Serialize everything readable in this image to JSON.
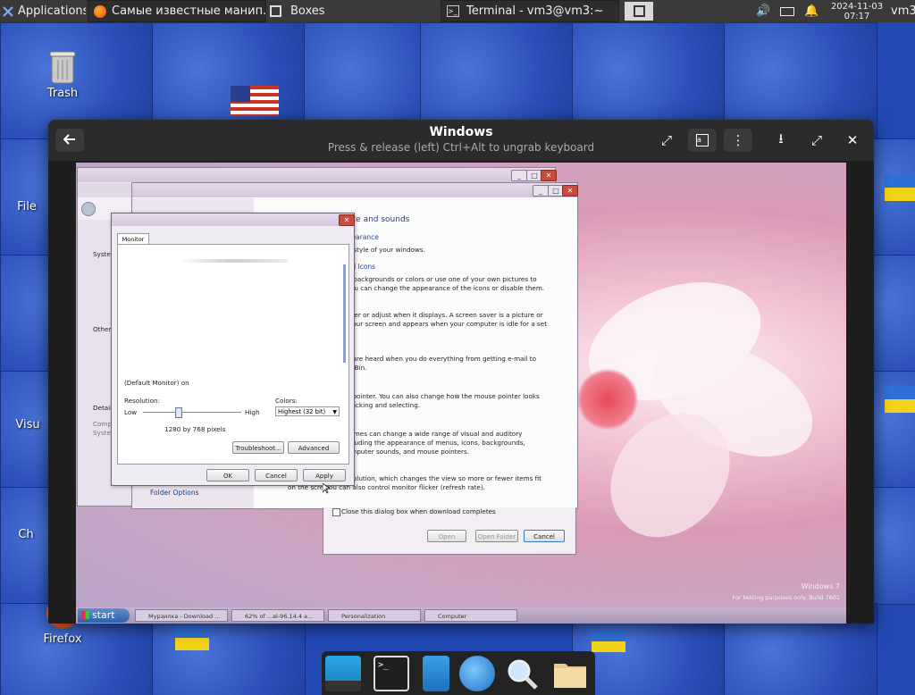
{
  "topbar": {
    "applications_label": "Applications",
    "tasks": [
      {
        "label": "Самые известные манип...",
        "icon": "firefox-icon"
      },
      {
        "label": "Boxes",
        "icon": "boxes-icon"
      },
      {
        "label": "Terminal - vm3@vm3:~",
        "icon": "terminal-icon"
      }
    ],
    "date": "2024-11-03",
    "time": "07:17",
    "user": "vm3"
  },
  "desktop_icons": [
    {
      "label": "Trash"
    },
    {
      "label": "File"
    },
    {
      "label": "Visu"
    },
    {
      "label": "Ch"
    },
    {
      "label": "Firefox"
    }
  ],
  "boxes_window": {
    "title": "Windows",
    "subtitle": "Press & release (left) Ctrl+Alt to ungrab keyboard"
  },
  "guest": {
    "monitor_dialog": {
      "tab": "Monitor",
      "default_monitor": "(Default Monitor) on",
      "resolution_label": "Resolution:",
      "low": "Low",
      "high": "High",
      "resolution_value": "1280 by 768 pixels",
      "resolution_fraction": 0.35,
      "colors_label": "Colors:",
      "colors_value": "Highest (32 bit)",
      "troubleshoot": "Troubleshoot...",
      "advanced": "Advanced",
      "ok": "OK",
      "cancel": "Cancel",
      "apply": "Apply"
    },
    "personalization": {
      "heading": "ance and sounds",
      "link_appearance": "ppearance",
      "line_style": "nd style of your windows.",
      "link_icons": "and Icons",
      "desc_icons_1": "de backgrounds or colors or use one of your own pictures to",
      "desc_icons_2": ". You can change the appearance of the icons or disable them.",
      "desc_saver_1": "saver or adjust when it displays. A screen saver is a picture or",
      "desc_saver_2": "s your screen and appears when your computer is idle for a set",
      "desc_sounds_1": "ds are heard when you do everything from getting e-mail to",
      "desc_sounds_2": "cle Bin.",
      "desc_pointer_1": "se pointer. You can also change how the mouse pointer looks",
      "desc_pointer_2": "s clicking and selecting.",
      "desc_themes_1": "themes can change a wide range of visual and auditory",
      "desc_themes_2": "including the appearance of menus, icons, backgrounds,",
      "desc_themes_3": "computer sounds, and mouse pointers.",
      "desc_display_1": "resolution, which changes the view so more or fewer items fit",
      "desc_display_2": "on the scre   You can also control monitor flicker (refresh rate)."
    },
    "left_panel": {
      "system": "Syster",
      "other": "Other",
      "detail": "Detail",
      "comp": "Comp",
      "syste": "Syste",
      "folder_options": "Folder Options"
    },
    "download_dialog": {
      "close_checkbox": "Close this dialog box when download completes",
      "open": "Open",
      "open_folder": "Open Folder",
      "cancel": "Cancel"
    },
    "watermark_1": "Windows 7",
    "watermark_2": "For testing purposes only. Build 7601",
    "taskbar": {
      "start": "start",
      "items": [
        "Мурзилка - Download ...",
        "62% of ...al-96.14.4 a...",
        "Personalization",
        "Computer"
      ]
    }
  },
  "colors": {
    "topbar_bg": "#3a3a3a",
    "boxes_header": "#2b2b2b",
    "accent_blue": "#1a3fa8",
    "desktop_blue": "#2249b3"
  }
}
